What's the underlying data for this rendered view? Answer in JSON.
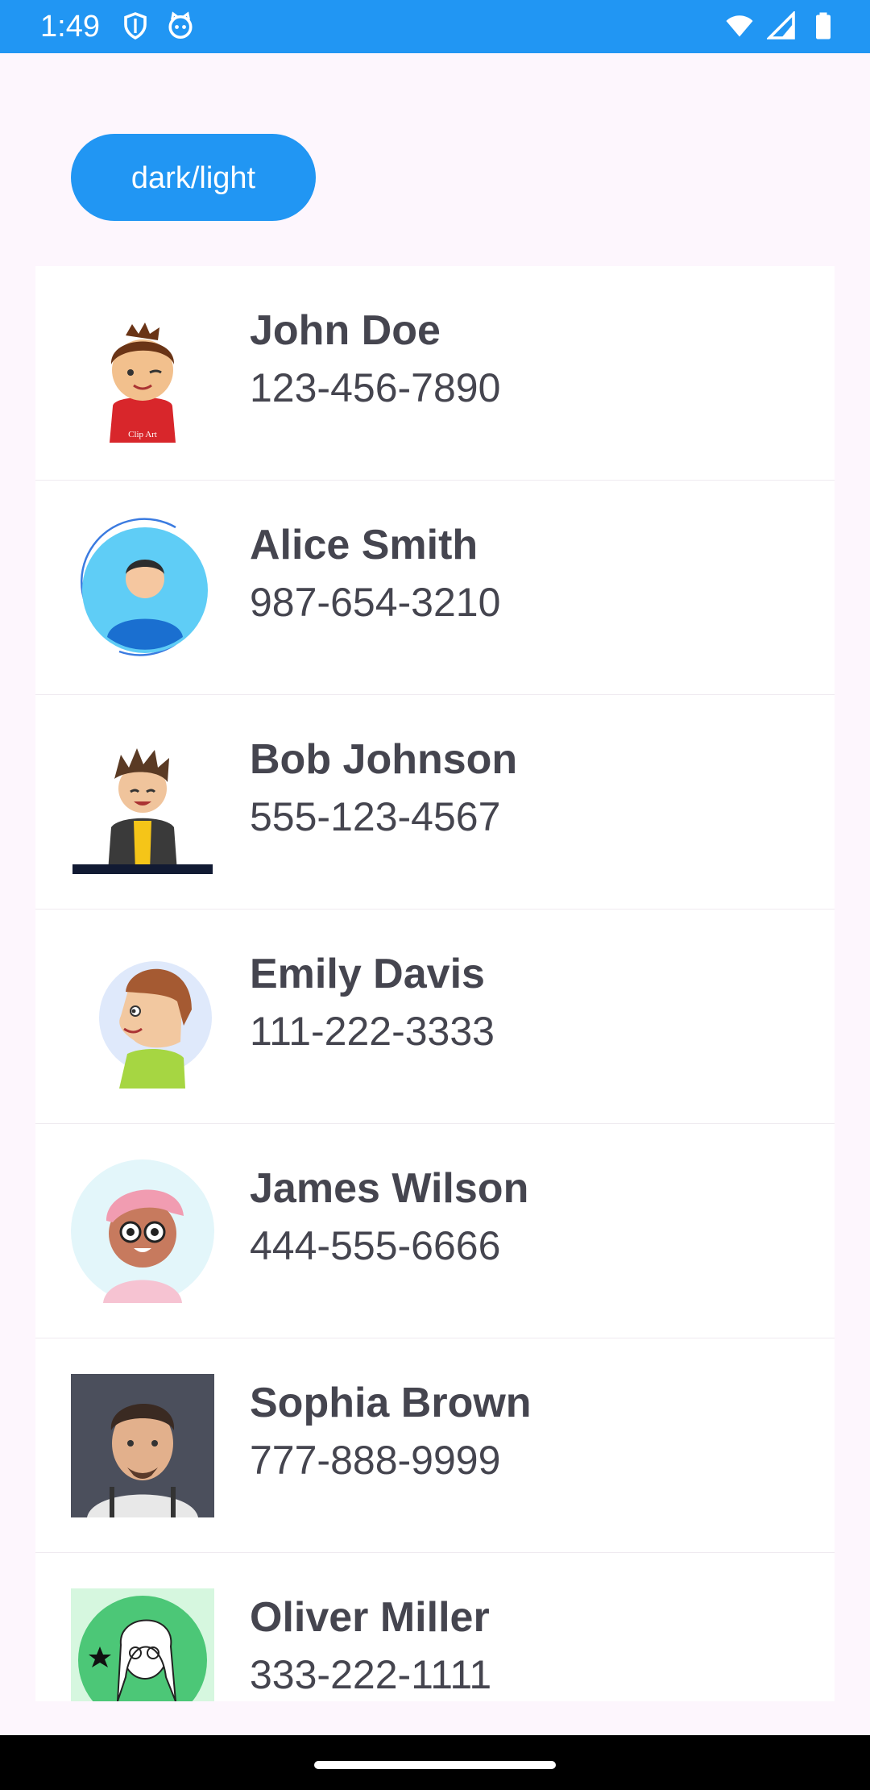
{
  "status_bar": {
    "time": "1:49",
    "left_icons": [
      "shield-icon",
      "cat-face-icon"
    ],
    "right_icons": [
      "wifi-icon",
      "signal-icon",
      "battery-icon"
    ],
    "background": "#2196f3"
  },
  "toggle_button": {
    "label": "dark/light",
    "color": "#2196f3"
  },
  "contacts": [
    {
      "name": "John Doe",
      "phone": "123-456-7890",
      "avatar": "cartoon-boy-red-shirt"
    },
    {
      "name": "Alice Smith",
      "phone": "987-654-3210",
      "avatar": "man-blue-circle"
    },
    {
      "name": "Bob Johnson",
      "phone": "555-123-4567",
      "avatar": "cartoon-boy-jacket"
    },
    {
      "name": "Emily Davis",
      "phone": "111-222-3333",
      "avatar": "cartoon-profile-green-shirt"
    },
    {
      "name": "James Wilson",
      "phone": "444-555-6666",
      "avatar": "cartoon-pink-hat"
    },
    {
      "name": "Sophia Brown",
      "phone": "777-888-9999",
      "avatar": "3d-man-portrait"
    },
    {
      "name": "Oliver Miller",
      "phone": "333-222-1111",
      "avatar": "cartoon-girl-green-circle"
    }
  ]
}
